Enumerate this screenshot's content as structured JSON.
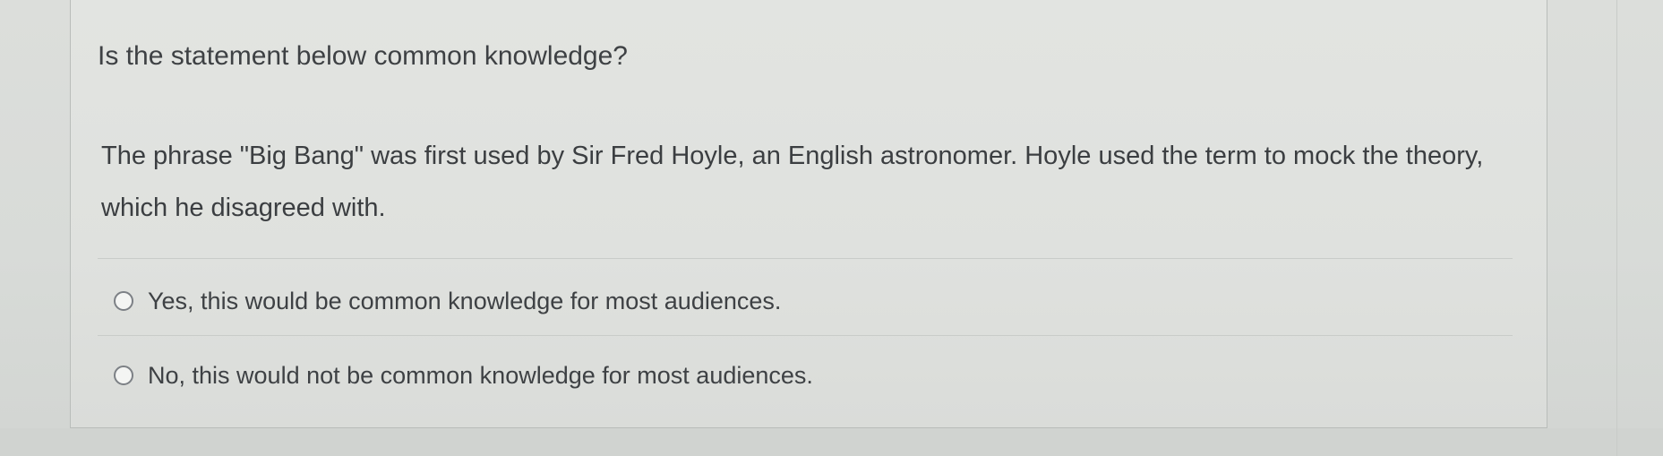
{
  "question": {
    "prompt": "Is the statement below common knowledge?",
    "statement": "The phrase \"Big Bang\" was first used by Sir Fred Hoyle, an English astronomer. Hoyle used the term to mock the theory, which he disagreed with.",
    "options": [
      {
        "label": "Yes, this would be common knowledge for most audiences.",
        "selected": false
      },
      {
        "label": "No, this would not be common knowledge for most audiences.",
        "selected": false
      }
    ]
  },
  "colors": {
    "background": "#d6d9d6",
    "card": "#e0e2df",
    "text": "#3b3e41",
    "radio_border": "#7c8085"
  }
}
